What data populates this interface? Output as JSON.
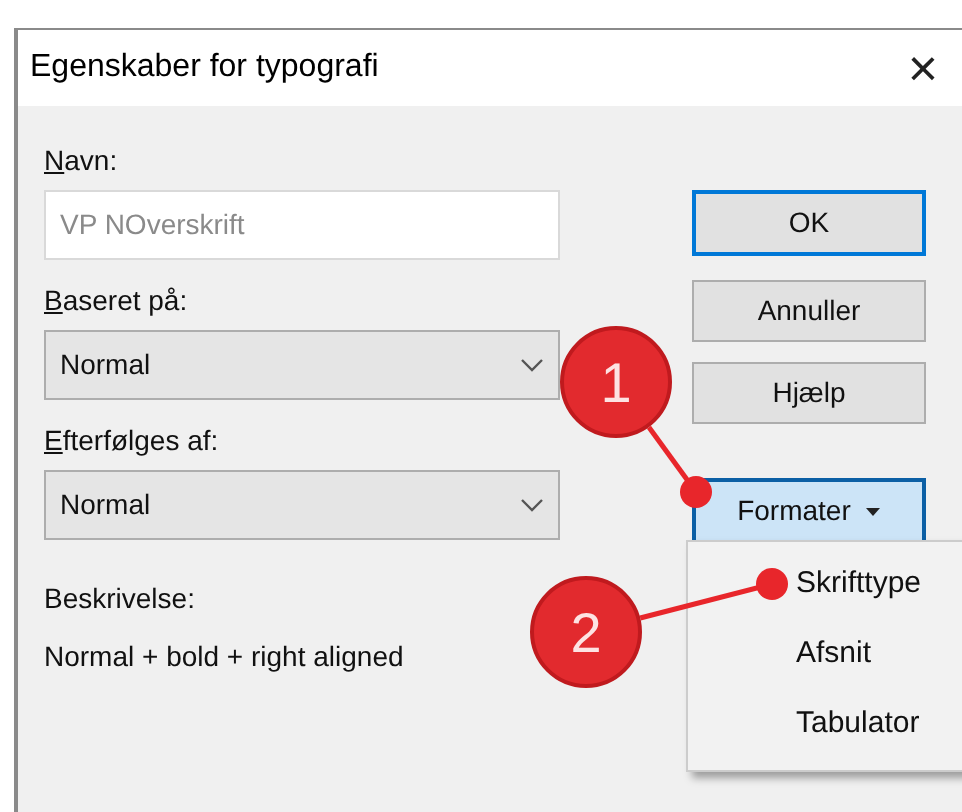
{
  "window": {
    "title": "Egenskaber for typografi",
    "close": "×"
  },
  "fields": [
    {
      "kind": "text",
      "label": "Navn:",
      "mnemonic": true,
      "value": "VP NOverskrift",
      "disabled": true
    },
    {
      "kind": "select",
      "label": "Baseret på:",
      "mnemonic": true,
      "value": "Normal",
      "disabled": false
    },
    {
      "kind": "select",
      "label": "Efterfølges af:",
      "mnemonic": true,
      "value": "Normal",
      "disabled": false
    }
  ],
  "description": {
    "label": "Beskrivelse:",
    "text": "Normal + bold + right aligned"
  },
  "buttons": [
    {
      "label": "OK",
      "default": true
    },
    {
      "label": "Annuller",
      "default": false
    },
    {
      "label": "Hjælp",
      "default": false
    }
  ],
  "format_button": {
    "label": "Formater",
    "expanded": true
  },
  "menu": {
    "items": [
      {
        "label": "Skrifttype"
      },
      {
        "label": "Afsnit"
      },
      {
        "label": "Tabulator"
      }
    ]
  },
  "callouts": [
    "1",
    "2"
  ]
}
